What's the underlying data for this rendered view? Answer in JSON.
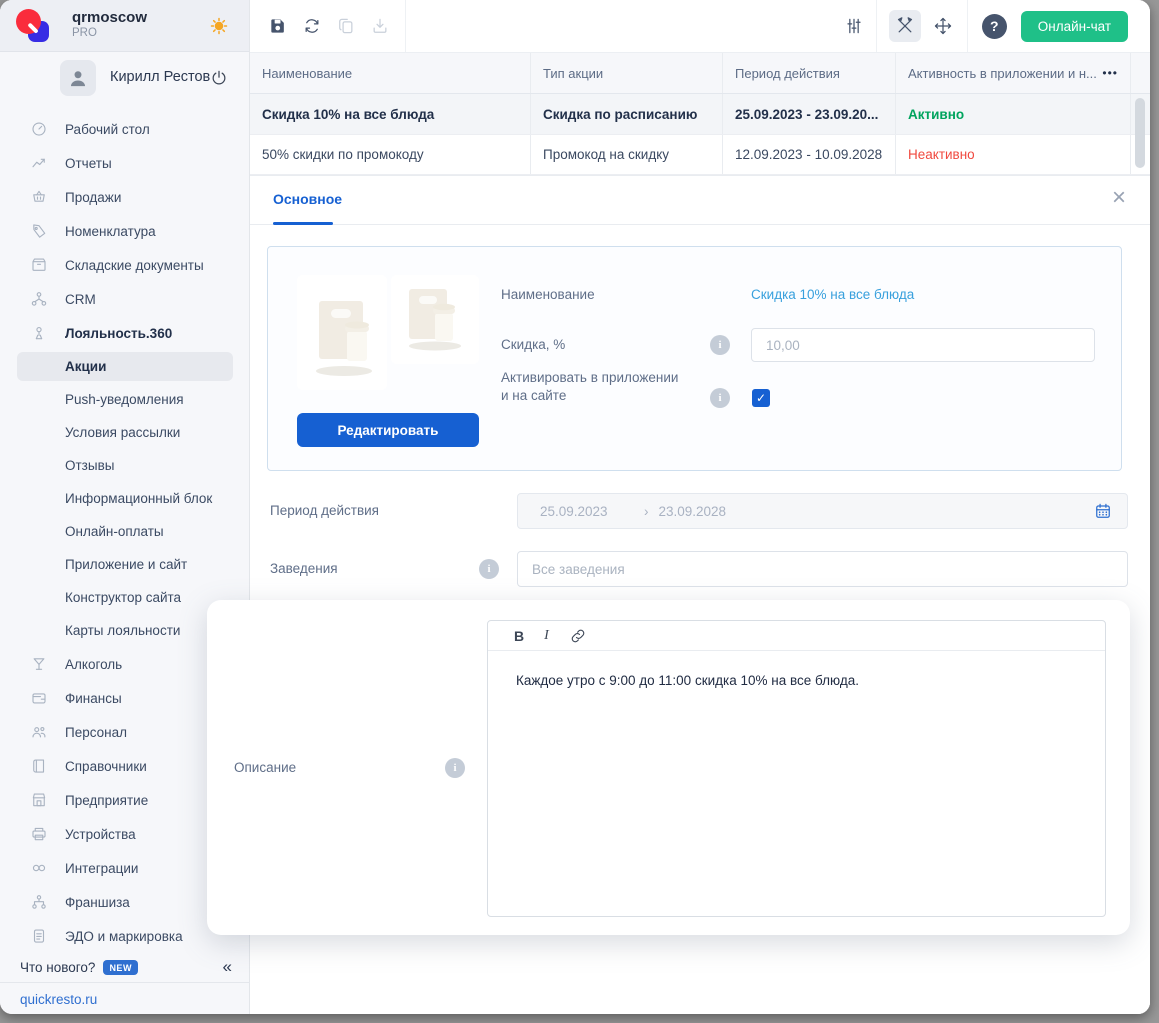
{
  "app": {
    "brand": "qrmoscow",
    "plan": "PRO",
    "site_link": "quickresto.ru"
  },
  "sidebar": {
    "user": {
      "name": "Кирилл Рестов"
    },
    "items": [
      {
        "label": "Рабочий стол",
        "icon": "dashboard"
      },
      {
        "label": "Отчеты",
        "icon": "reports"
      },
      {
        "label": "Продажи",
        "icon": "sales"
      },
      {
        "label": "Номенклатура",
        "icon": "tag"
      },
      {
        "label": "Складские документы",
        "icon": "warehouse"
      },
      {
        "label": "CRM",
        "icon": "crm"
      },
      {
        "label": "Лояльность.360",
        "icon": "loyalty",
        "bold": true
      },
      {
        "label": "Акции",
        "sub": true,
        "active": true
      },
      {
        "label": "Push-уведомления",
        "sub": true
      },
      {
        "label": "Условия рассылки",
        "sub": true
      },
      {
        "label": "Отзывы",
        "sub": true
      },
      {
        "label": "Информационный блок",
        "sub": true
      },
      {
        "label": "Онлайн-оплаты",
        "sub": true
      },
      {
        "label": "Приложение и сайт",
        "sub": true
      },
      {
        "label": "Конструктор сайта",
        "sub": true
      },
      {
        "label": "Карты лояльности",
        "sub": true
      },
      {
        "label": "Алкоголь",
        "icon": "alcohol"
      },
      {
        "label": "Финансы",
        "icon": "finance"
      },
      {
        "label": "Персонал",
        "icon": "staff"
      },
      {
        "label": "Справочники",
        "icon": "directories"
      },
      {
        "label": "Предприятие",
        "icon": "enterprise"
      },
      {
        "label": "Устройства",
        "icon": "devices"
      },
      {
        "label": "Интеграции",
        "icon": "integrations"
      },
      {
        "label": "Франшиза",
        "icon": "franchise"
      },
      {
        "label": "ЭДО и маркировка",
        "icon": "edo"
      }
    ],
    "whats_new": "Что нового?",
    "badge": "NEW",
    "collapse": "«"
  },
  "toolbar": {
    "chat_button": "Онлайн-чат",
    "help": "?"
  },
  "table": {
    "columns": [
      "Наименование",
      "Тип акции",
      "Период действия",
      "Активность в приложении и н..."
    ],
    "more": "•••",
    "rows": [
      {
        "name": "Скидка 10% на все блюда",
        "type": "Скидка по расписанию",
        "period": "25.09.2023 - 23.09.20...",
        "status": "Активно"
      },
      {
        "name": "50% скидки по промокоду",
        "type": "Промокод на скидку",
        "period": "12.09.2023 - 10.09.2028",
        "status": "Неактивно"
      }
    ]
  },
  "panel": {
    "tab": "Основное",
    "close": "×",
    "edit_button": "Редактировать",
    "fields": {
      "name": {
        "label": "Наименование",
        "value": "Скидка 10% на все блюда"
      },
      "discount": {
        "label": "Скидка, %",
        "value": "10,00",
        "info": "i"
      },
      "activate": {
        "label": "Активировать в приложении и на сайте",
        "checked": true,
        "check": "✓",
        "info": "i"
      },
      "period": {
        "label": "Период действия",
        "from": "25.09.2023",
        "sep": "›",
        "to": "23.09.2028"
      },
      "venues": {
        "label": "Заведения",
        "placeholder": "Все заведения",
        "info": "i"
      },
      "description": {
        "label": "Описание",
        "bold": "B",
        "italic": "I",
        "text": "Каждое утро с 9:00 до 11:00 скидка 10% на все блюда.",
        "info": "i"
      }
    }
  },
  "colors": {
    "accent": "#1660d2",
    "link": "#38a0dd",
    "status_active": "#00a45e",
    "status_inactive": "#f0493f",
    "chat": "#1fc088",
    "badge": "#2f6fd0",
    "sun": "#f5a623"
  }
}
